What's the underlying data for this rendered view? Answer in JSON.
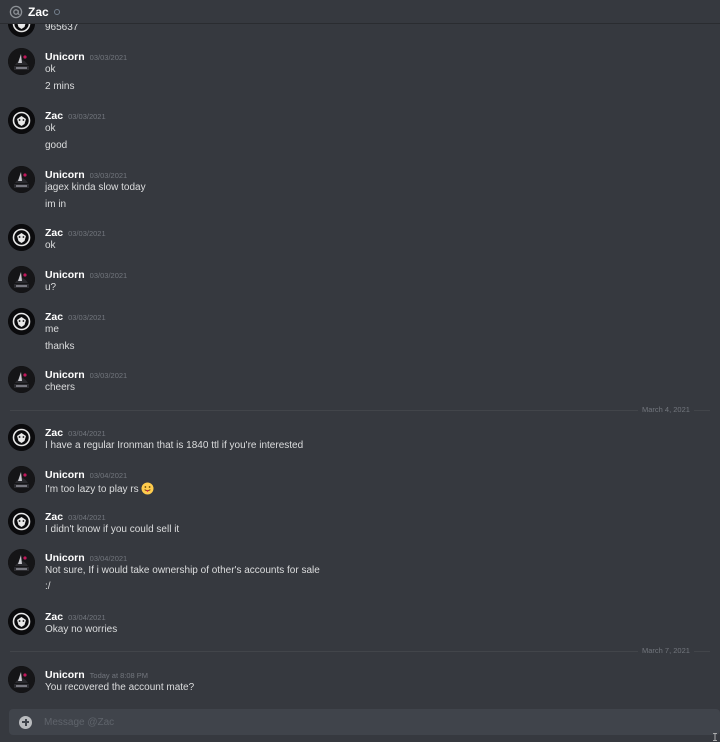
{
  "header": {
    "channel_name": "Zac",
    "at_icon": "at-icon",
    "status": "offline"
  },
  "partial_top": {
    "text": "965637"
  },
  "messages": [
    {
      "author": "Unicorn",
      "timestamp": "03/03/2021",
      "avatar": "unicorn-avatar",
      "lines": [
        "ok",
        "2 mins"
      ]
    },
    {
      "author": "Zac",
      "timestamp": "03/03/2021",
      "avatar": "lion-avatar",
      "lines": [
        "ok",
        "good"
      ]
    },
    {
      "author": "Unicorn",
      "timestamp": "03/03/2021",
      "avatar": "unicorn-avatar",
      "lines": [
        "jagex kinda slow today",
        "im in"
      ]
    },
    {
      "author": "Zac",
      "timestamp": "03/03/2021",
      "avatar": "lion-avatar",
      "lines": [
        "ok"
      ]
    },
    {
      "author": "Unicorn",
      "timestamp": "03/03/2021",
      "avatar": "unicorn-avatar",
      "lines": [
        "u?"
      ]
    },
    {
      "author": "Zac",
      "timestamp": "03/03/2021",
      "avatar": "lion-avatar",
      "lines": [
        "me",
        "thanks"
      ]
    },
    {
      "author": "Unicorn",
      "timestamp": "03/03/2021",
      "avatar": "unicorn-avatar",
      "lines": [
        "cheers"
      ]
    },
    {
      "author": "Zac",
      "timestamp": "03/04/2021",
      "avatar": "lion-avatar",
      "lines": [
        "I have a regular Ironman that is 1840 ttl if you're interested"
      ]
    },
    {
      "author": "Unicorn",
      "timestamp": "03/04/2021",
      "avatar": "unicorn-avatar",
      "lines": [
        "I'm too lazy to play rs"
      ],
      "emoji": "tongue-out-emoji"
    },
    {
      "author": "Zac",
      "timestamp": "03/04/2021",
      "avatar": "lion-avatar",
      "lines": [
        "I didn't know if you could sell it"
      ]
    },
    {
      "author": "Unicorn",
      "timestamp": "03/04/2021",
      "avatar": "unicorn-avatar",
      "lines": [
        "Not sure, If i would take ownership of other's accounts for sale",
        ":/"
      ]
    },
    {
      "author": "Zac",
      "timestamp": "03/04/2021",
      "avatar": "lion-avatar",
      "lines": [
        "Okay no worries"
      ]
    },
    {
      "author": "Unicorn",
      "timestamp": "Today at 8:08 PM",
      "avatar": "unicorn-avatar",
      "lines": [
        "You recovered the account mate?"
      ]
    }
  ],
  "dividers": [
    "March 4, 2021",
    "March 7, 2021"
  ],
  "composer": {
    "placeholder": "Message @Zac",
    "value": "",
    "plus_icon": "add-attachment-icon"
  },
  "colors": {
    "background": "#36393f",
    "composer": "#40444b",
    "author": "#ffffff",
    "text": "#dcddde",
    "timestamp": "#72767d"
  }
}
